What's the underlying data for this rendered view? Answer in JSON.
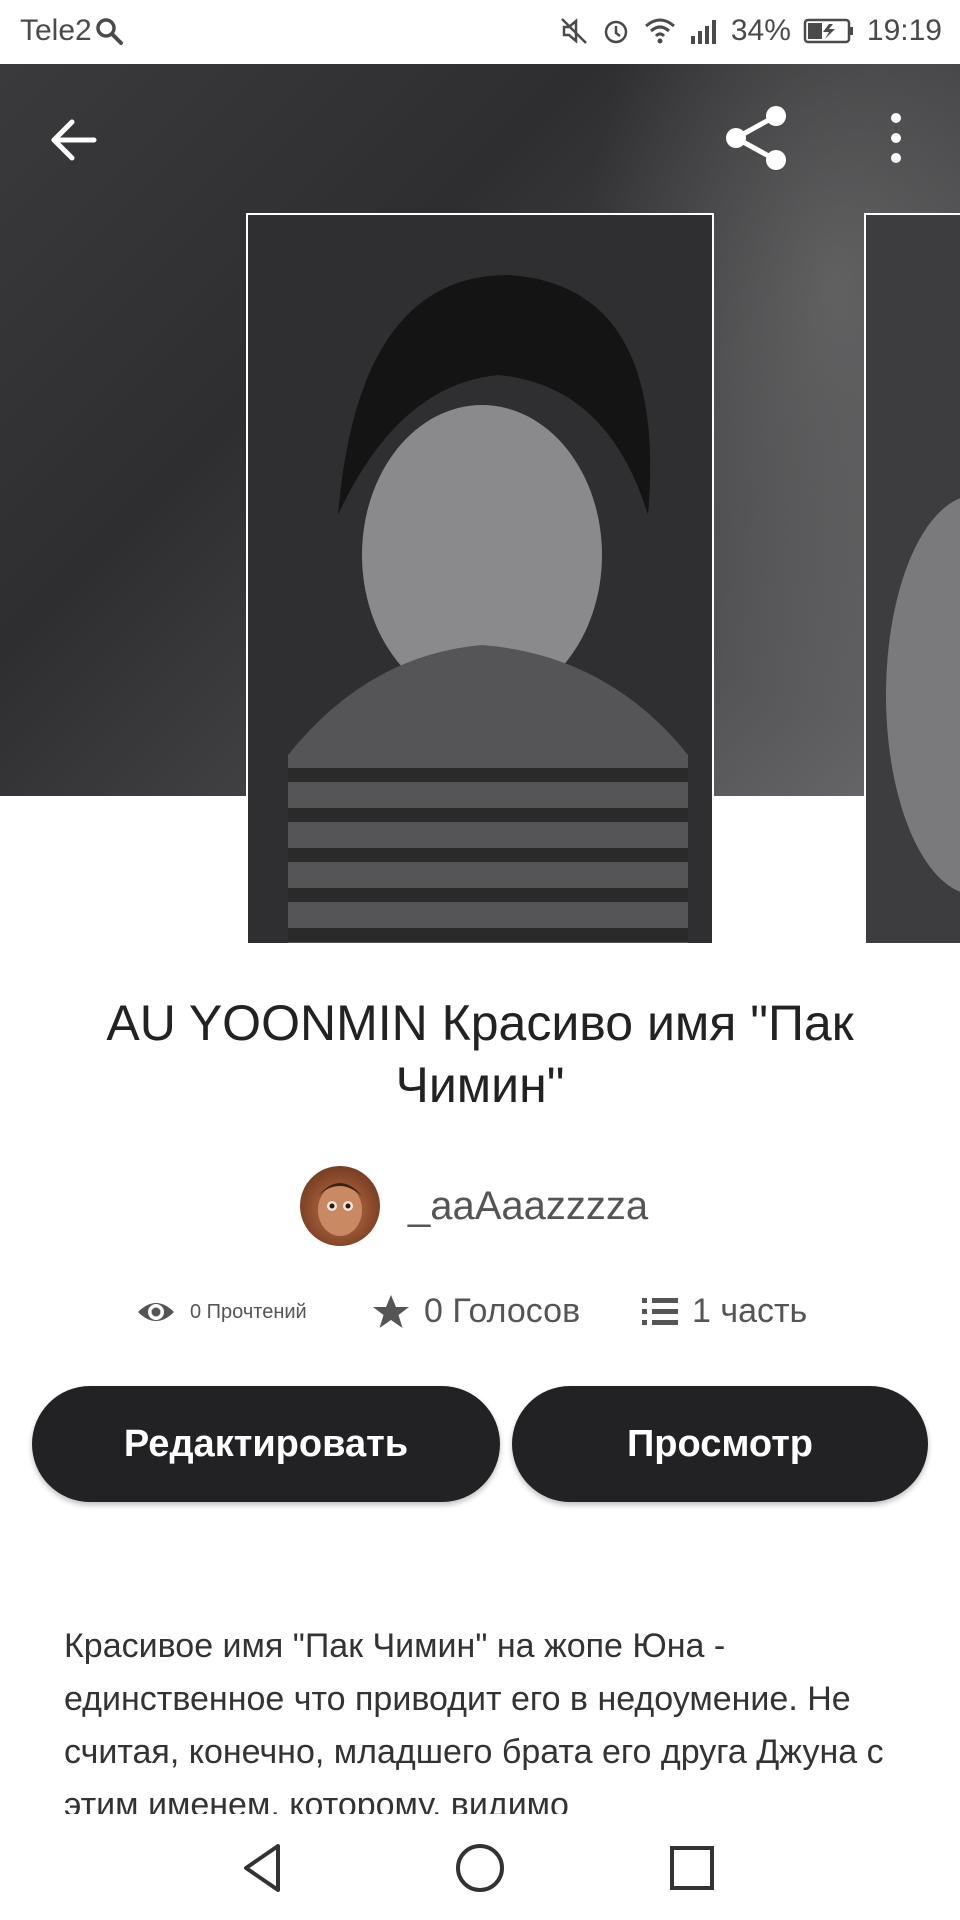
{
  "status_bar": {
    "carrier": "Tele2",
    "battery": "34%",
    "time": "19:19"
  },
  "story": {
    "title": "AU YOONMIN Красиво имя \"Пак Чимин\"",
    "author": "_aaAaazzzza",
    "reads": "0 Прочтений",
    "votes": "0 Голосов",
    "parts": "1 часть",
    "description": "Красивое имя \"Пак Чимин\" на жопе Юна - единственное что приводит его в недоумение. Не считая, конечно, младшего брата его друга Джуна с этим именем, которому, видимо"
  },
  "actions": {
    "edit_label": "Редактировать",
    "view_label": "Просмотр"
  },
  "colors": {
    "button_bg": "#222124",
    "header_bg": "#3a3a3c",
    "text": "#222222"
  }
}
